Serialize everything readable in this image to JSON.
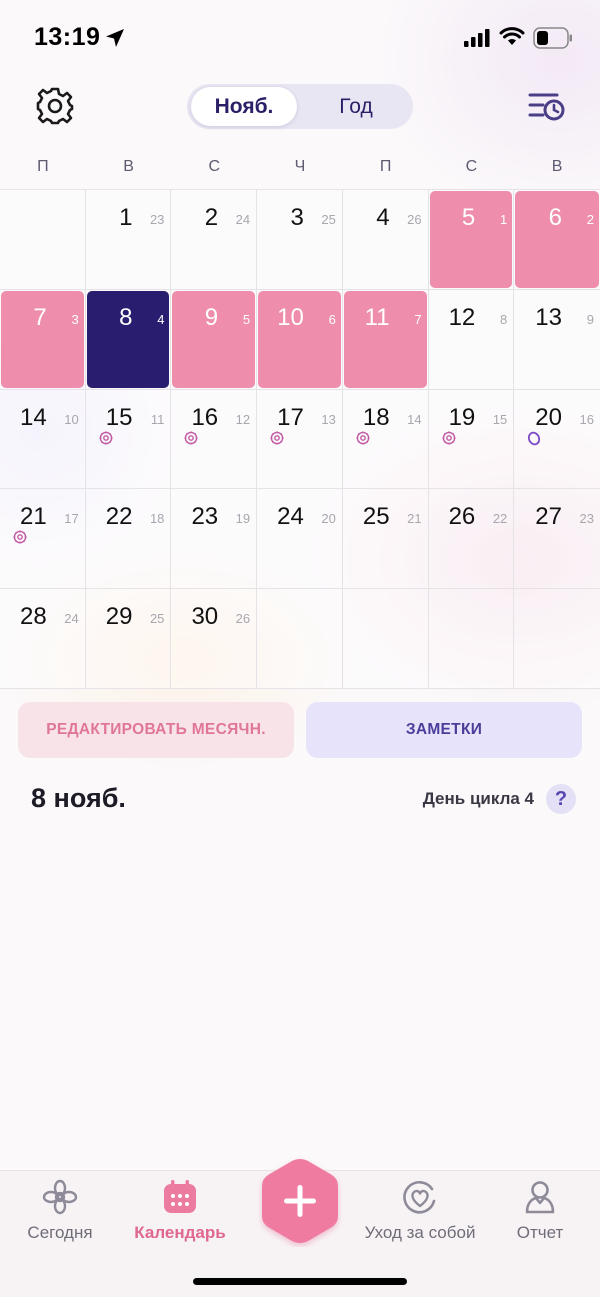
{
  "status_bar": {
    "time": "13:19"
  },
  "header": {
    "segments": {
      "month": "Нояб.",
      "year": "Год"
    }
  },
  "weekdays": [
    "П",
    "В",
    "С",
    "Ч",
    "П",
    "С",
    "В"
  ],
  "calendar": {
    "cells": [
      {
        "day": "",
        "cycle": "",
        "state": "empty"
      },
      {
        "day": "1",
        "cycle": "23",
        "state": "normal"
      },
      {
        "day": "2",
        "cycle": "24",
        "state": "normal"
      },
      {
        "day": "3",
        "cycle": "25",
        "state": "normal"
      },
      {
        "day": "4",
        "cycle": "26",
        "state": "normal"
      },
      {
        "day": "5",
        "cycle": "1",
        "state": "period"
      },
      {
        "day": "6",
        "cycle": "2",
        "state": "period"
      },
      {
        "day": "7",
        "cycle": "3",
        "state": "period"
      },
      {
        "day": "8",
        "cycle": "4",
        "state": "today"
      },
      {
        "day": "9",
        "cycle": "5",
        "state": "period"
      },
      {
        "day": "10",
        "cycle": "6",
        "state": "period"
      },
      {
        "day": "11",
        "cycle": "7",
        "state": "period"
      },
      {
        "day": "12",
        "cycle": "8",
        "state": "normal"
      },
      {
        "day": "13",
        "cycle": "9",
        "state": "normal"
      },
      {
        "day": "14",
        "cycle": "10",
        "state": "normal"
      },
      {
        "day": "15",
        "cycle": "11",
        "state": "normal",
        "marker": "fertile-flower-icon"
      },
      {
        "day": "16",
        "cycle": "12",
        "state": "normal",
        "marker": "fertile-flower-icon"
      },
      {
        "day": "17",
        "cycle": "13",
        "state": "normal",
        "marker": "fertile-flower-icon"
      },
      {
        "day": "18",
        "cycle": "14",
        "state": "normal",
        "marker": "fertile-flower-icon"
      },
      {
        "day": "19",
        "cycle": "15",
        "state": "normal",
        "marker": "fertile-flower-icon"
      },
      {
        "day": "20",
        "cycle": "16",
        "state": "normal",
        "marker": "ovulation-ring-icon"
      },
      {
        "day": "21",
        "cycle": "17",
        "state": "normal",
        "marker": "fertile-flower-icon"
      },
      {
        "day": "22",
        "cycle": "18",
        "state": "normal"
      },
      {
        "day": "23",
        "cycle": "19",
        "state": "normal"
      },
      {
        "day": "24",
        "cycle": "20",
        "state": "normal"
      },
      {
        "day": "25",
        "cycle": "21",
        "state": "normal"
      },
      {
        "day": "26",
        "cycle": "22",
        "state": "normal"
      },
      {
        "day": "27",
        "cycle": "23",
        "state": "normal"
      },
      {
        "day": "28",
        "cycle": "24",
        "state": "normal"
      },
      {
        "day": "29",
        "cycle": "25",
        "state": "normal"
      },
      {
        "day": "30",
        "cycle": "26",
        "state": "normal"
      },
      {
        "day": "",
        "cycle": "",
        "state": "empty"
      },
      {
        "day": "",
        "cycle": "",
        "state": "empty"
      },
      {
        "day": "",
        "cycle": "",
        "state": "empty"
      },
      {
        "day": "",
        "cycle": "",
        "state": "empty"
      }
    ]
  },
  "actions": {
    "edit_period": "РЕДАКТИРОВАТЬ МЕСЯЧН.",
    "notes": "ЗАМЕТКИ"
  },
  "details": {
    "selected_date": "8 нояб.",
    "cycle_day": "День цикла 4",
    "help": "?"
  },
  "tabbar": {
    "today": "Сегодня",
    "calendar": "Календарь",
    "self_care": "Уход за собой",
    "report": "Отчет"
  },
  "colors": {
    "period": "#ee8eac",
    "today": "#281d6e",
    "accent": "#e0678f",
    "notes_bg": "#e6e3fa",
    "edit_bg": "#f8e3e9"
  }
}
